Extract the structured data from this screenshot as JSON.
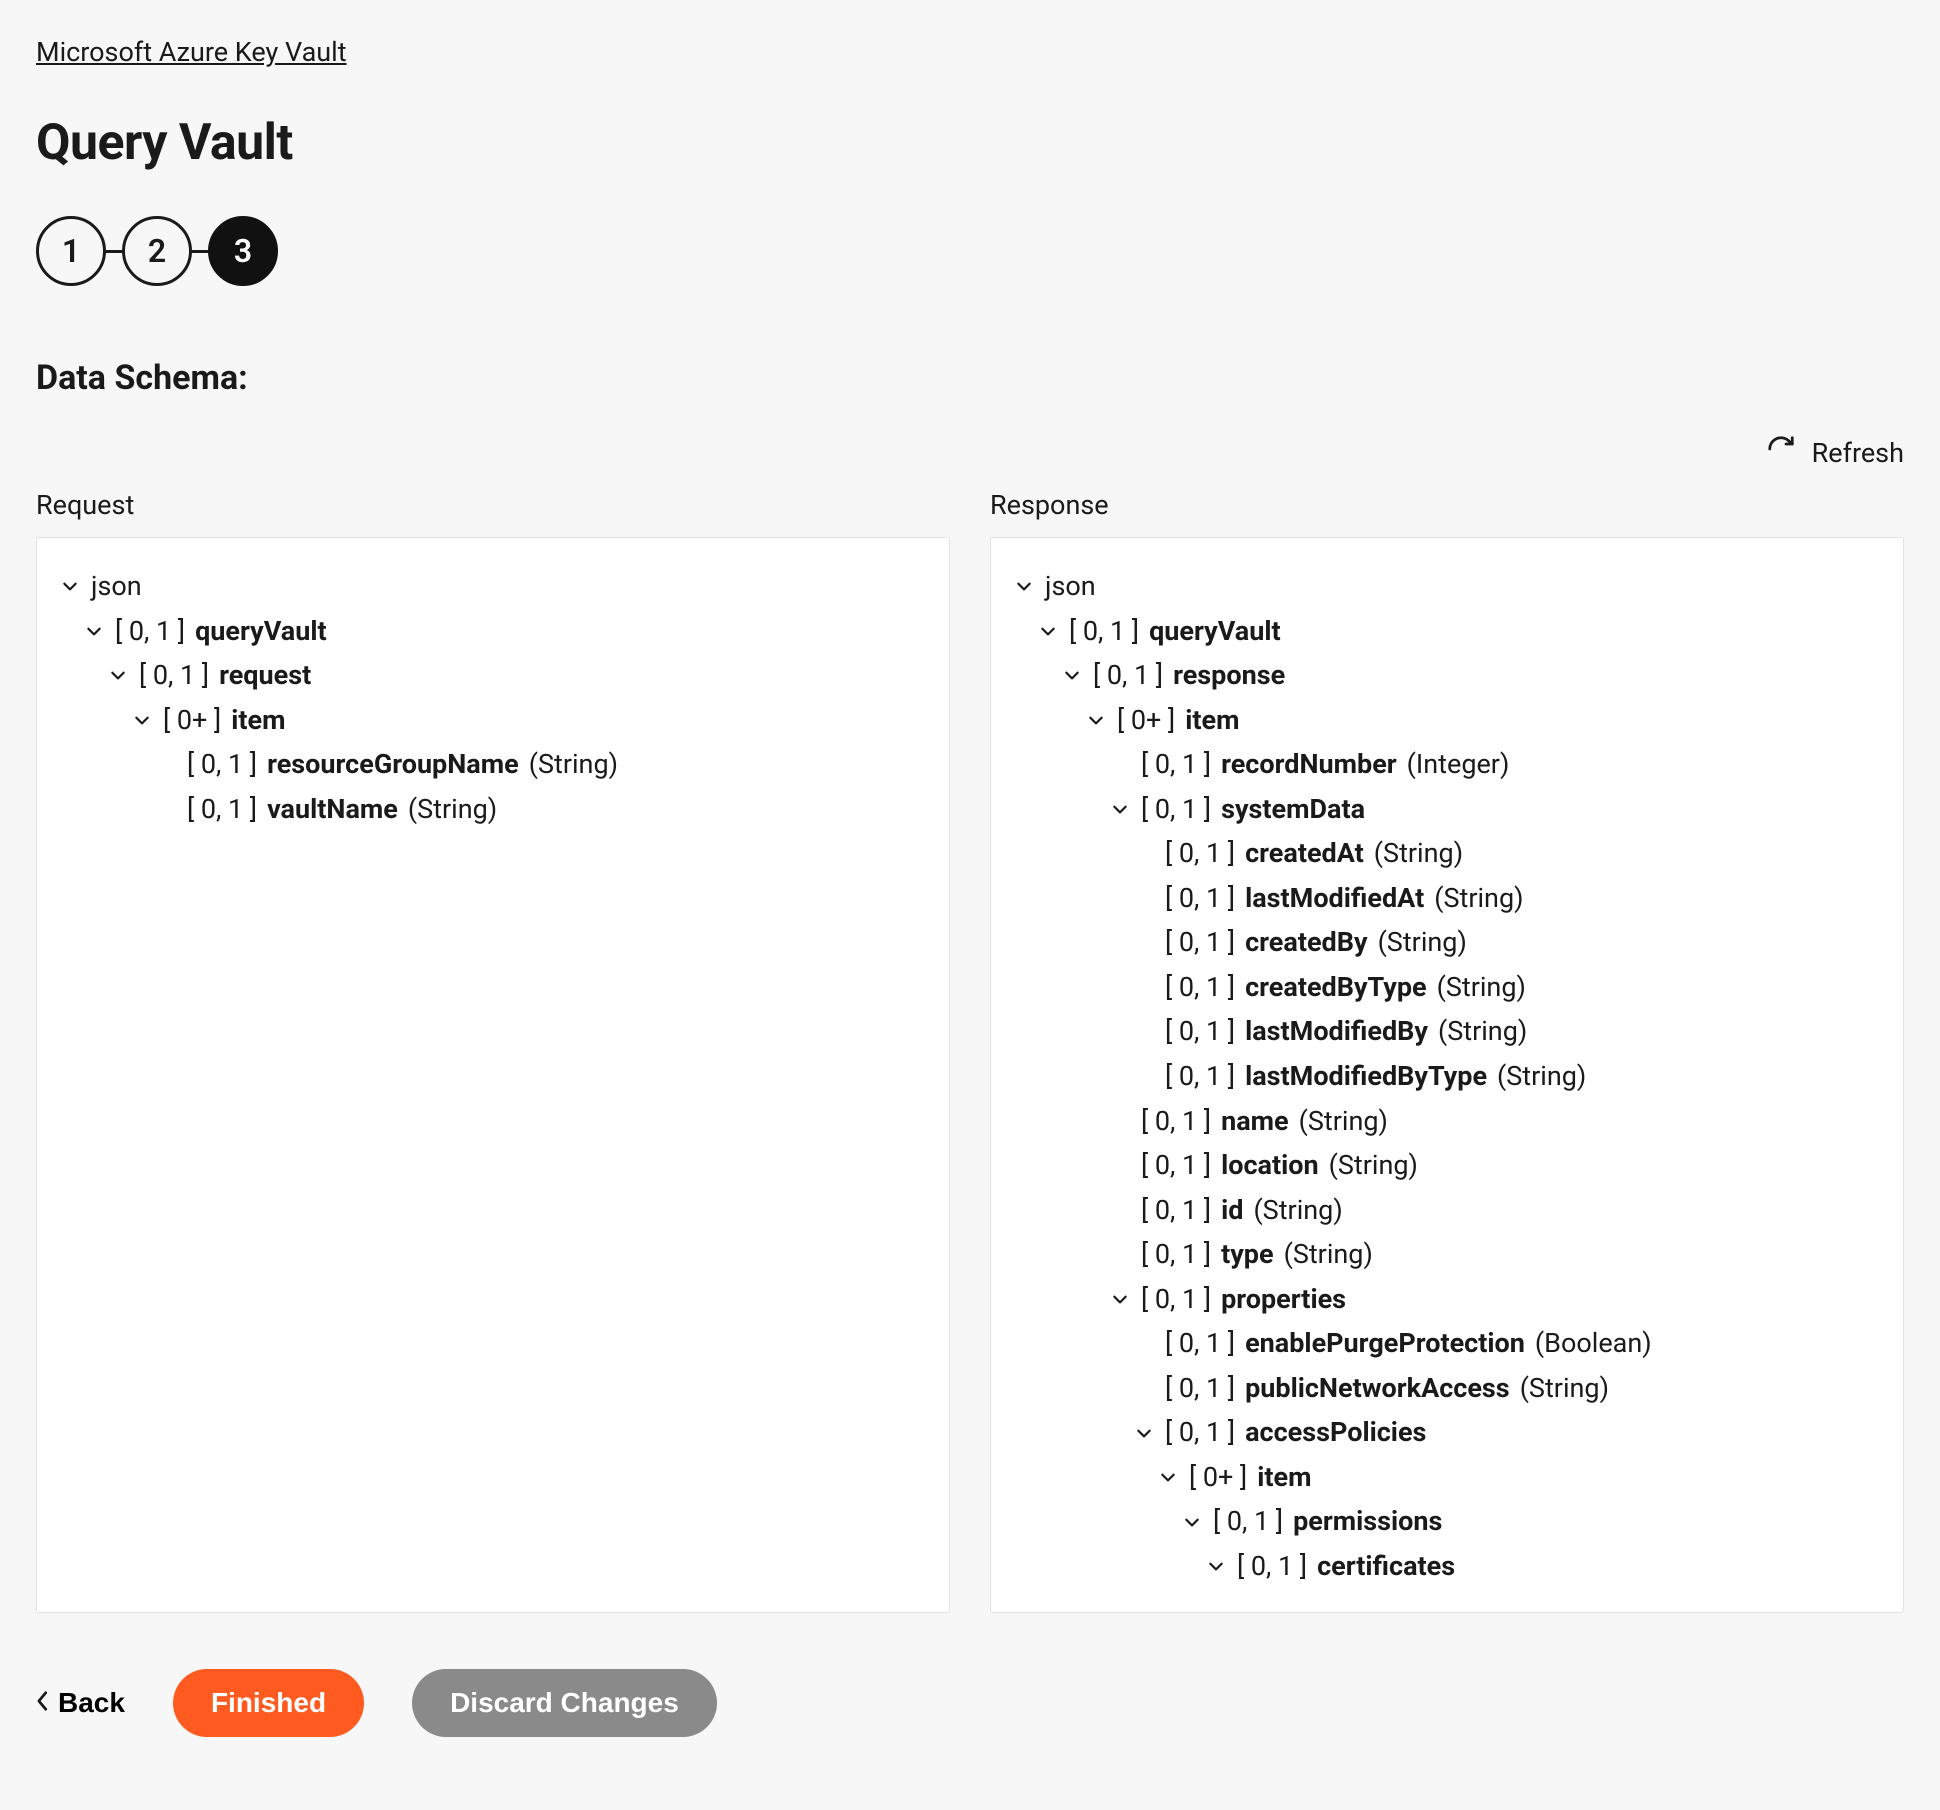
{
  "breadcrumb": "Microsoft Azure Key Vault",
  "pageTitle": "Query Vault",
  "stepper": {
    "steps": [
      "1",
      "2",
      "3"
    ],
    "activeIndex": 2
  },
  "sectionTitle": "Data Schema:",
  "refreshLabel": "Refresh",
  "panels": {
    "request": {
      "label": "Request",
      "root": "json",
      "rows": [
        {
          "indent": 1,
          "chev": true,
          "card": "[ 0, 1 ]",
          "name": "queryVault",
          "type": ""
        },
        {
          "indent": 2,
          "chev": true,
          "card": "[ 0, 1 ]",
          "name": "request",
          "type": ""
        },
        {
          "indent": 3,
          "chev": true,
          "card": "[ 0+ ]",
          "name": "item",
          "type": ""
        },
        {
          "indent": 4,
          "chev": false,
          "card": "[ 0, 1 ]",
          "name": "resourceGroupName",
          "type": "(String)"
        },
        {
          "indent": 4,
          "chev": false,
          "card": "[ 0, 1 ]",
          "name": "vaultName",
          "type": "(String)"
        }
      ]
    },
    "response": {
      "label": "Response",
      "root": "json",
      "rows": [
        {
          "indent": 1,
          "chev": true,
          "card": "[ 0, 1 ]",
          "name": "queryVault",
          "type": ""
        },
        {
          "indent": 2,
          "chev": true,
          "card": "[ 0, 1 ]",
          "name": "response",
          "type": ""
        },
        {
          "indent": 3,
          "chev": true,
          "card": "[ 0+ ]",
          "name": "item",
          "type": ""
        },
        {
          "indent": 4,
          "chev": false,
          "card": "[ 0, 1 ]",
          "name": "recordNumber",
          "type": "(Integer)"
        },
        {
          "indent": 4,
          "chev": true,
          "card": "[ 0, 1 ]",
          "name": "systemData",
          "type": ""
        },
        {
          "indent": 5,
          "chev": false,
          "card": "[ 0, 1 ]",
          "name": "createdAt",
          "type": "(String)"
        },
        {
          "indent": 5,
          "chev": false,
          "card": "[ 0, 1 ]",
          "name": "lastModifiedAt",
          "type": "(String)"
        },
        {
          "indent": 5,
          "chev": false,
          "card": "[ 0, 1 ]",
          "name": "createdBy",
          "type": "(String)"
        },
        {
          "indent": 5,
          "chev": false,
          "card": "[ 0, 1 ]",
          "name": "createdByType",
          "type": "(String)"
        },
        {
          "indent": 5,
          "chev": false,
          "card": "[ 0, 1 ]",
          "name": "lastModifiedBy",
          "type": "(String)"
        },
        {
          "indent": 5,
          "chev": false,
          "card": "[ 0, 1 ]",
          "name": "lastModifiedByType",
          "type": "(String)"
        },
        {
          "indent": 4,
          "chev": false,
          "card": "[ 0, 1 ]",
          "name": "name",
          "type": "(String)"
        },
        {
          "indent": 4,
          "chev": false,
          "card": "[ 0, 1 ]",
          "name": "location",
          "type": "(String)"
        },
        {
          "indent": 4,
          "chev": false,
          "card": "[ 0, 1 ]",
          "name": "id",
          "type": "(String)"
        },
        {
          "indent": 4,
          "chev": false,
          "card": "[ 0, 1 ]",
          "name": "type",
          "type": "(String)"
        },
        {
          "indent": 4,
          "chev": true,
          "card": "[ 0, 1 ]",
          "name": "properties",
          "type": ""
        },
        {
          "indent": 5,
          "chev": false,
          "card": "[ 0, 1 ]",
          "name": "enablePurgeProtection",
          "type": "(Boolean)"
        },
        {
          "indent": 5,
          "chev": false,
          "card": "[ 0, 1 ]",
          "name": "publicNetworkAccess",
          "type": "(String)"
        },
        {
          "indent": 5,
          "chev": true,
          "card": "[ 0, 1 ]",
          "name": "accessPolicies",
          "type": ""
        },
        {
          "indent": 6,
          "chev": true,
          "card": "[ 0+ ]",
          "name": "item",
          "type": ""
        },
        {
          "indent": 7,
          "chev": true,
          "card": "[ 0, 1 ]",
          "name": "permissions",
          "type": ""
        },
        {
          "indent": 8,
          "chev": true,
          "card": "[ 0, 1 ]",
          "name": "certificates",
          "type": ""
        }
      ]
    }
  },
  "footer": {
    "back": "Back",
    "finished": "Finished",
    "discard": "Discard Changes"
  }
}
